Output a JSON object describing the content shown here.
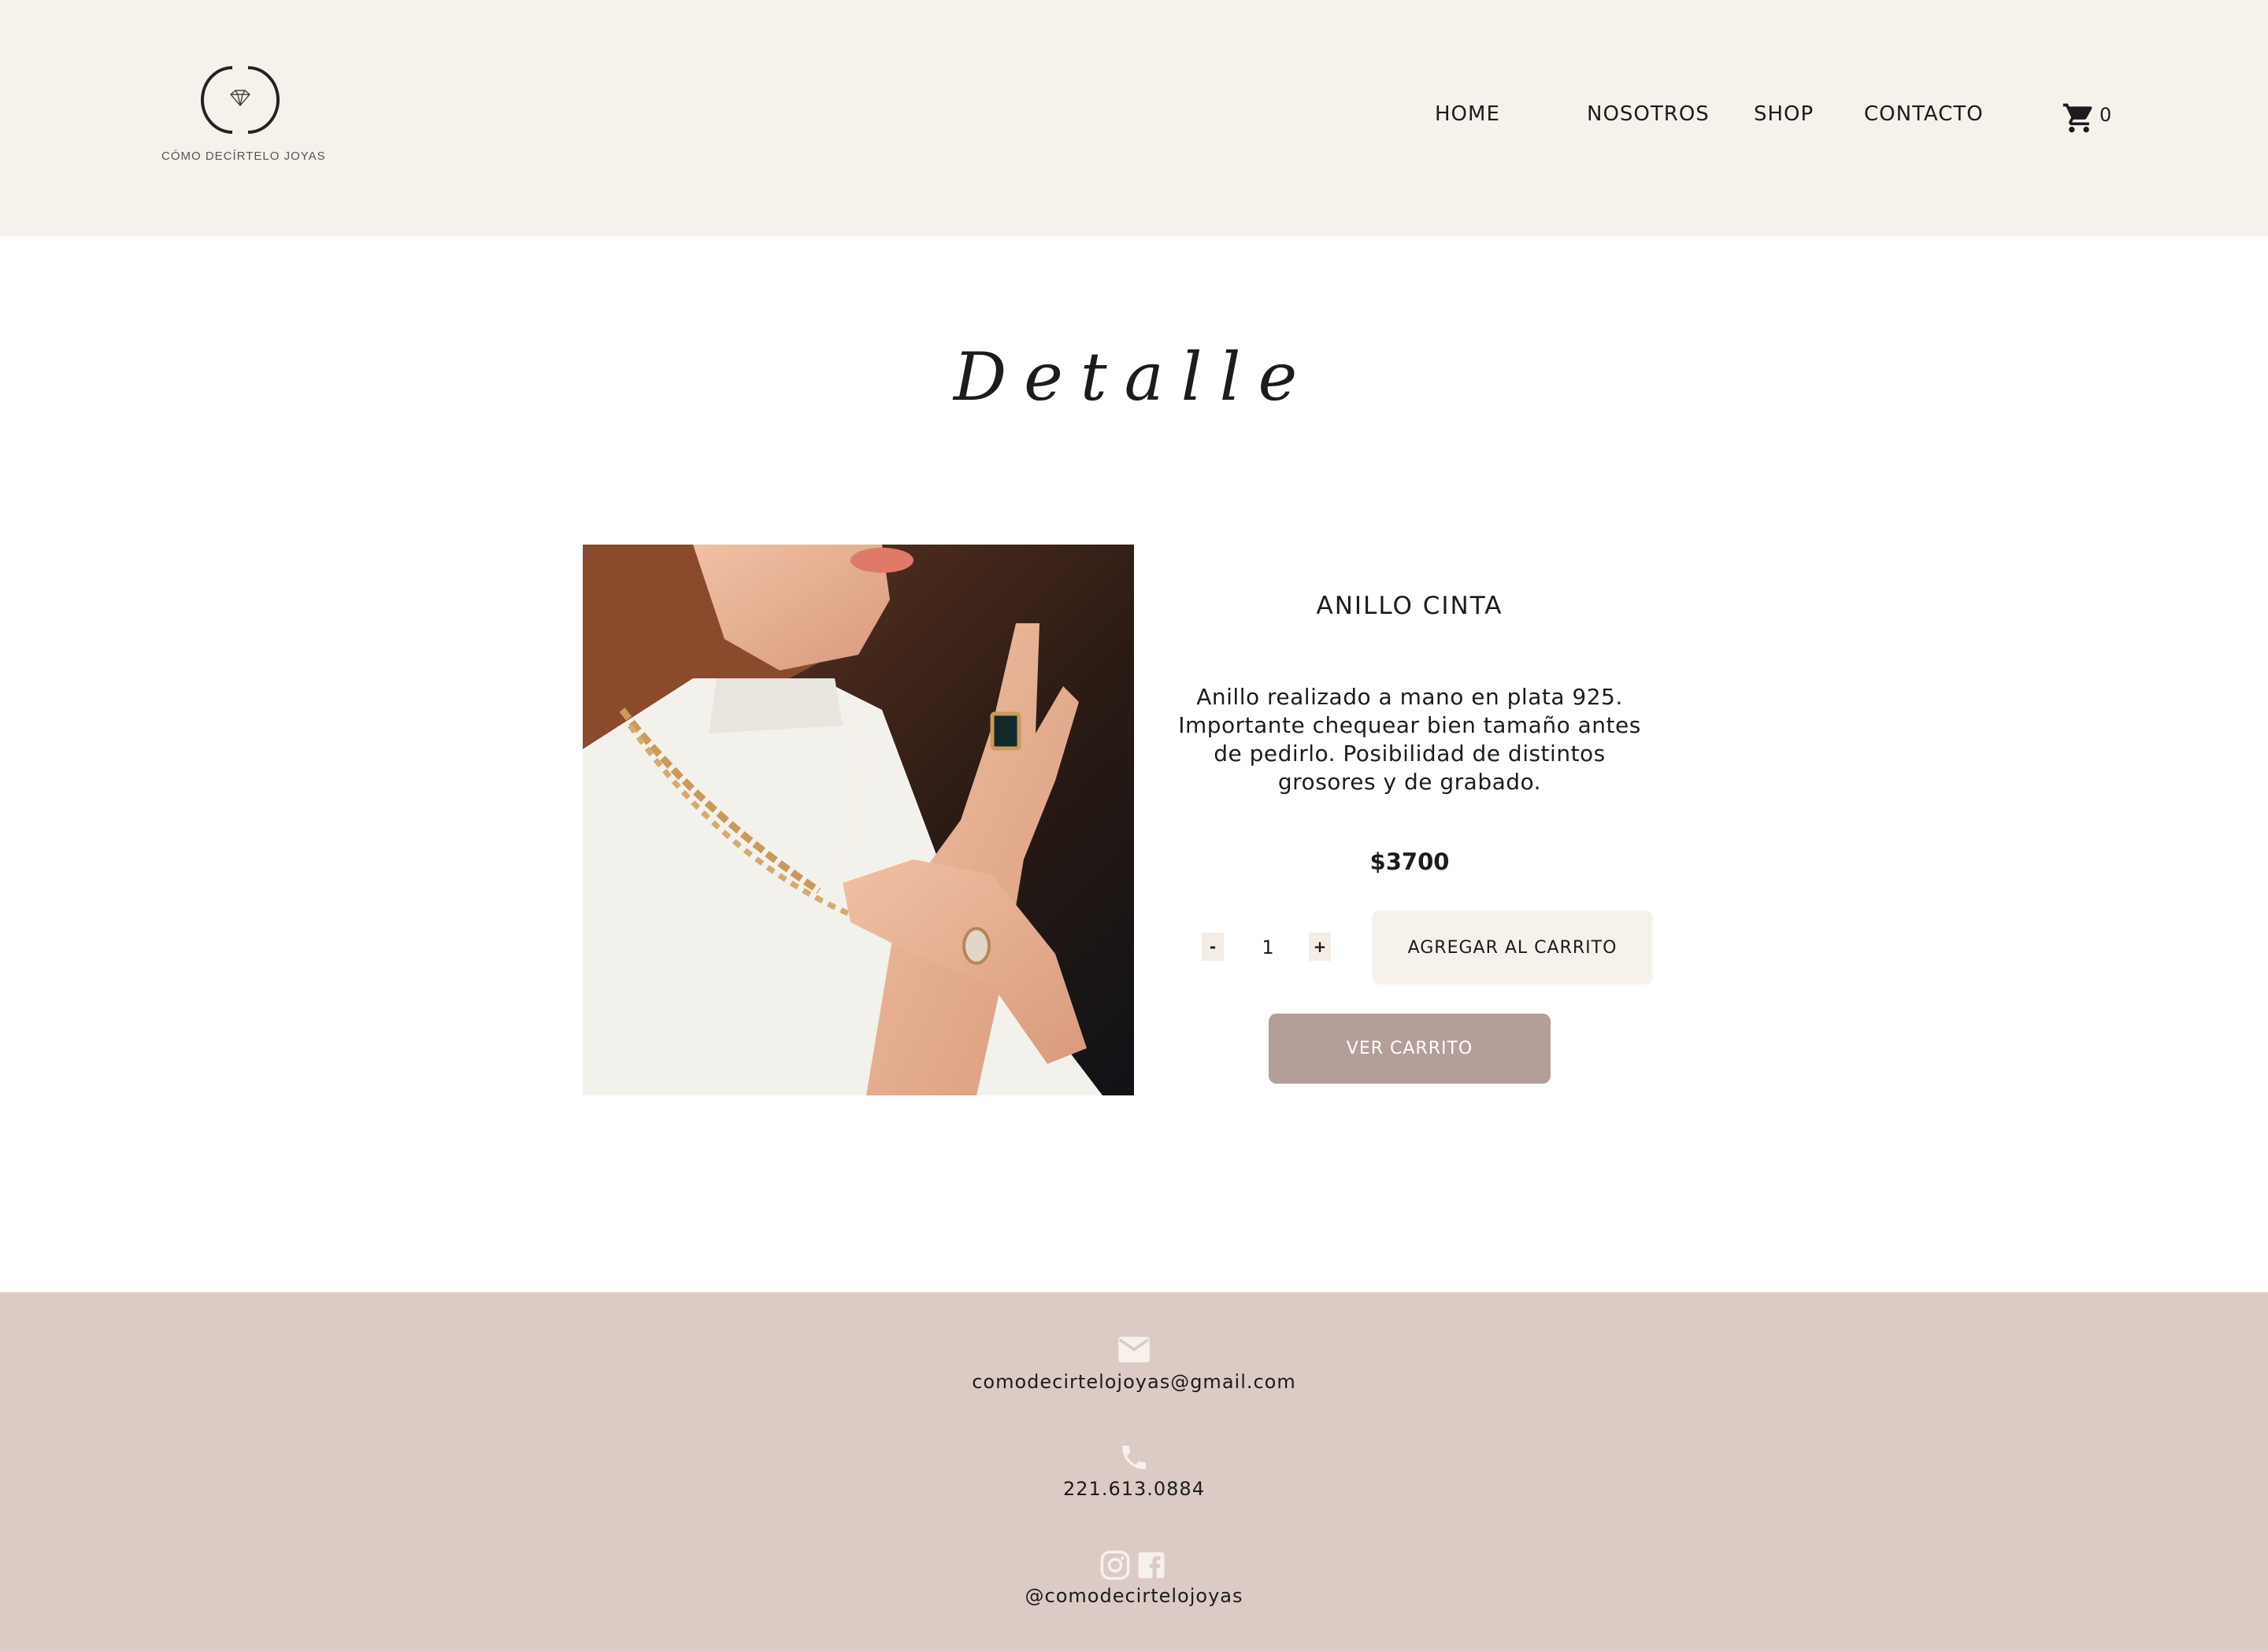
{
  "header": {
    "logo_text": "CÓMO DECÍRTELO JOYAS",
    "nav": [
      {
        "label": "HOME"
      },
      {
        "label": "NOSOTROS"
      },
      {
        "label": "SHOP"
      },
      {
        "label": "CONTACTO"
      }
    ],
    "cart_count": "0"
  },
  "page": {
    "title": "Detalle"
  },
  "product": {
    "name": "ANILLO CINTA",
    "description": "Anillo realizado a mano en plata 925. Importante chequear bien tamaño antes de pedirlo. Posibilidad de distintos grosores y de grabado.",
    "price": "$3700",
    "quantity": "1",
    "decrement_label": "-",
    "increment_label": "+",
    "add_to_cart_label": "AGREGAR AL CARRITO",
    "view_cart_label": "VER CARRITO"
  },
  "footer": {
    "email": "comodecirtelojoyas@gmail.com",
    "phone": "221.613.0884",
    "social_handle": "@comodecirtelojoyas"
  },
  "colors": {
    "header_bg": "#f6f1eb",
    "footer_bg": "#dbcbc4",
    "view_cart_bg": "#b39e98",
    "add_cart_bg": "#f6f1eb"
  },
  "icons": [
    "diamond-logo-icon",
    "cart-icon",
    "mail-icon",
    "phone-icon",
    "instagram-icon",
    "facebook-icon"
  ]
}
